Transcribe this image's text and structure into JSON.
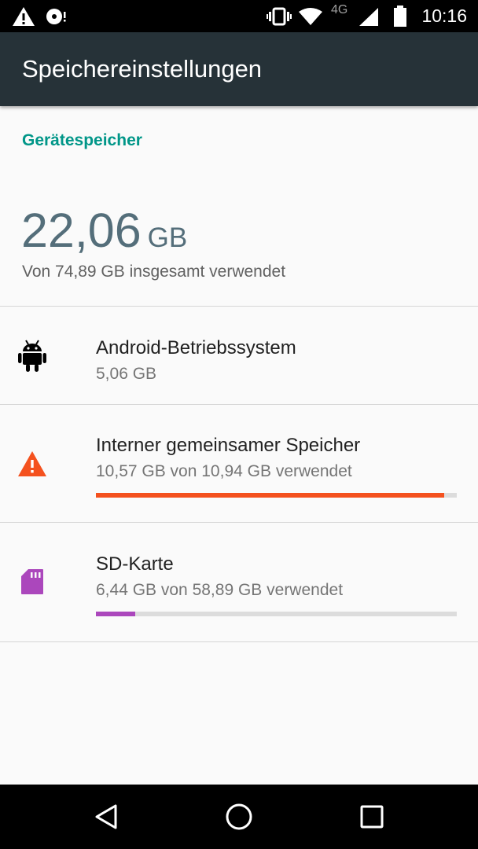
{
  "status_bar": {
    "time": "10:16",
    "network_type": "4G",
    "icons": [
      "warning-icon",
      "sync-disc-icon",
      "vibrate-icon",
      "wifi-icon",
      "signal-icon",
      "battery-icon"
    ]
  },
  "app_bar": {
    "title": "Speichereinstellungen",
    "background": "#263238"
  },
  "storage": {
    "section_header": "Gerätespeicher",
    "used_value": "22,06",
    "used_unit": "GB",
    "total_text": "Von 74,89 GB insgesamt verwendet"
  },
  "items": [
    {
      "title": "Android-Betriebssystem",
      "subtitle": "5,06 GB",
      "icon": "android-icon",
      "icon_color": "#000000"
    },
    {
      "title": "Interner gemeinsamer Speicher",
      "subtitle": "10,57 GB von 10,94 GB verwendet",
      "icon": "warning-icon",
      "icon_color": "#f4511e",
      "bar_fraction": 0.966,
      "bar_color": "#f4511e"
    },
    {
      "title": "SD-Karte",
      "subtitle": "6,44 GB von 58,89 GB verwendet",
      "icon": "sd-card-icon",
      "icon_color": "#ab47bc",
      "bar_fraction": 0.109,
      "bar_color": "#ab47bc"
    }
  ],
  "nav_bar": {
    "buttons": [
      "back-icon",
      "home-icon",
      "recents-icon"
    ]
  },
  "colors": {
    "accent": "#009688",
    "summary_text": "#546e7a"
  }
}
